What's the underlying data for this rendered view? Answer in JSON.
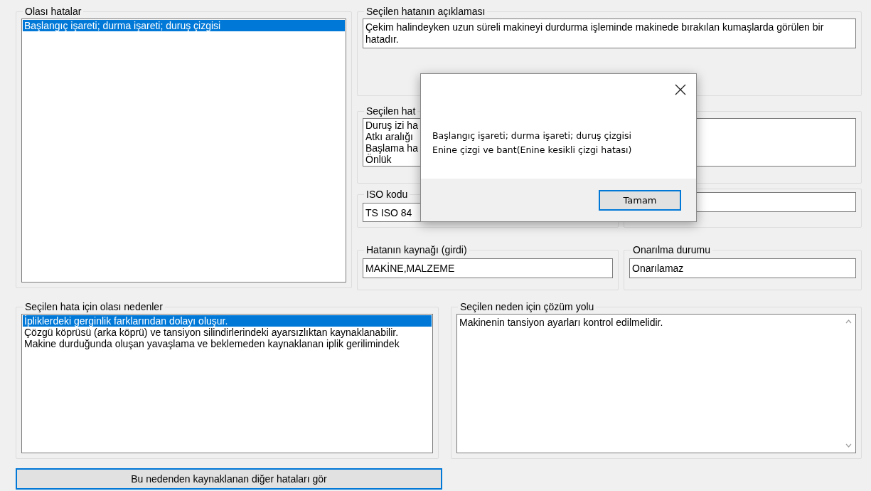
{
  "possible_errors": {
    "title": "Olası hatalar",
    "items": [
      {
        "label": "Başlangıç işareti; durma işareti; duruş çizgisi",
        "selected": true
      }
    ]
  },
  "description": {
    "title": "Seçilen hatanın açıklaması",
    "text": "Çekim halindeyken uzun süreli makineyi durdurma işleminde makinede bırakılan kumaşlarda görülen bir hatadır."
  },
  "related_errors": {
    "title": "Seçilen hat",
    "items": [
      {
        "label": "Duruş izi ha",
        "selected": false
      },
      {
        "label": "Atkı aralığı",
        "selected": false
      },
      {
        "label": "Başlama ha",
        "selected": false
      },
      {
        "label": "Önlük",
        "selected": false
      }
    ]
  },
  "iso_code": {
    "title": "ISO kodu",
    "value": "TS ISO 84"
  },
  "source": {
    "title": "Hatanın kaynağı (girdi)",
    "value": "MAKİNE,MALZEME"
  },
  "repair_status": {
    "title": "Onarılma durumu",
    "value": "Onarılamaz"
  },
  "causes": {
    "title": "Seçilen hata için olası nedenler",
    "items": [
      {
        "label": "İpliklerdeki gerginlik farklarından dolayı oluşur.",
        "selected": true
      },
      {
        "label": "Çözgü köprüsü (arka köprü) ve tansiyon silindirlerindeki ayarsızlıktan kaynaklanabilir.",
        "selected": false
      },
      {
        "label": "Makine durduğunda oluşan yavaşlama ve beklemeden kaynaklanan iplik gerilimindek",
        "selected": false
      }
    ]
  },
  "solution": {
    "title": "Seçilen neden için çözüm yolu",
    "text": "Makinenin tansiyon ayarları kontrol edilmelidir."
  },
  "other_errors_button": "Bu nedenden kaynaklanan diğer hataları gör",
  "dialog": {
    "lines": [
      "Başlangıç işareti; durma işareti; duruş çizgisi",
      "Enine çizgi ve bant(Enine kesikli çizgi hatası)"
    ],
    "ok_button": "Tamam"
  }
}
